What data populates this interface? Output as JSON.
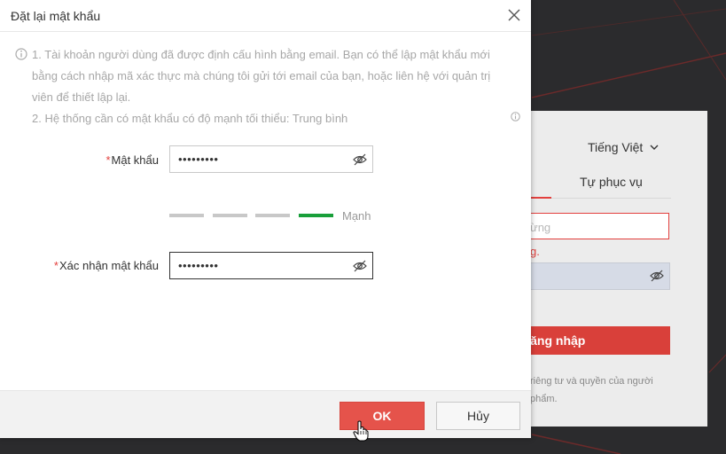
{
  "background": {
    "language": "Tiếng Việt",
    "tab_self_service": "Tự phục vụ",
    "username_placeholder_fragment": "ừng",
    "error_fragment": "g.",
    "login_button_fragment": "Đăng nhập",
    "privacy_fragment_line1": "riêng tư và quyền của người",
    "privacy_fragment_line2": "phẩm."
  },
  "dialog": {
    "title": "Đặt lại mật khẩu",
    "notice_line1": "1. Tài khoản người dùng đã được định cấu hình bằng email. Bạn có thể lập mật khẩu mới",
    "notice_line2": "bằng cách nhập mã xác thực mà chúng tôi gửi tới email của bạn, hoặc liên hệ với quản trị",
    "notice_line3": "viên để thiết lập lại.",
    "notice_line4": "2. Hệ thống cần có mật khẩu có độ mạnh tối thiểu: Trung bình",
    "required_mark": "*",
    "password_label": "Mật khẩu",
    "password_value": "•••••••••",
    "strength": {
      "level": 4,
      "segments": 4,
      "label": "Mạnh"
    },
    "confirm_label": "Xác nhận mật khẩu",
    "confirm_value": "•••••••••",
    "ok_label": "OK",
    "cancel_label": "Hủy"
  },
  "colors": {
    "accent_red": "#e5534b",
    "strength_green": "#199f3a",
    "segment_gray": "#c8c8c8"
  }
}
